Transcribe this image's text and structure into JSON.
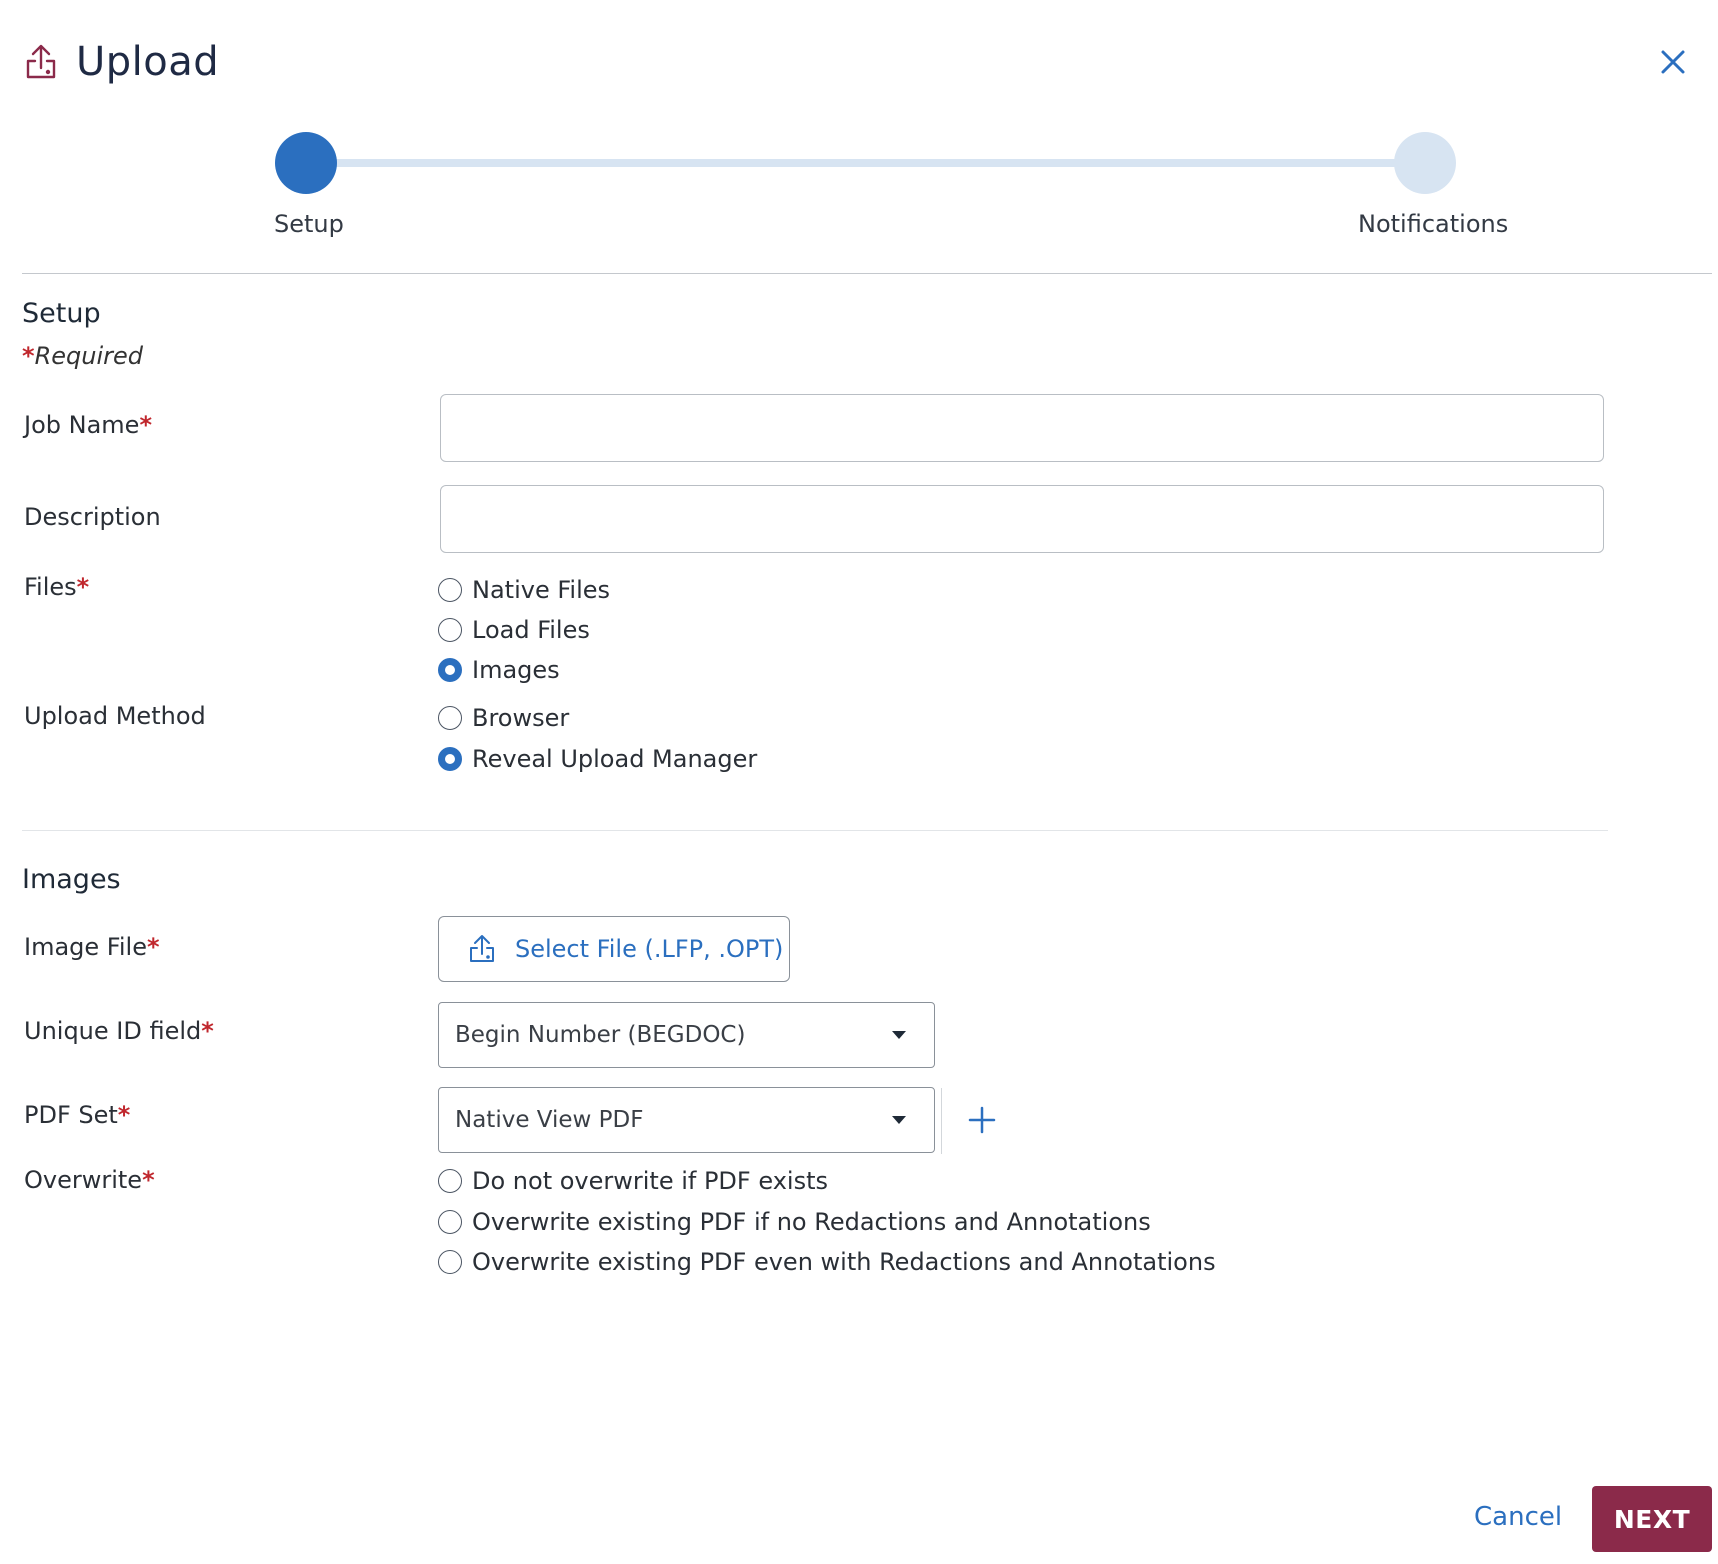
{
  "dialog": {
    "title": "Upload",
    "close_icon": "close-icon",
    "title_icon": "upload-icon"
  },
  "stepper": {
    "steps": [
      {
        "label": "Setup",
        "active": true
      },
      {
        "label": "Notifications",
        "active": false
      }
    ]
  },
  "setup": {
    "heading": "Setup",
    "required_asterisk": "*",
    "required_text": "Required",
    "job_name": {
      "label": "Job Name",
      "value": "",
      "required": true
    },
    "description": {
      "label": "Description",
      "value": ""
    },
    "files": {
      "label": "Files",
      "options": [
        {
          "label": "Native Files",
          "checked": false
        },
        {
          "label": "Load Files",
          "checked": false
        },
        {
          "label": "Images",
          "checked": true
        }
      ]
    },
    "upload_method": {
      "label": "Upload Method",
      "options": [
        {
          "label": "Browser",
          "checked": false
        },
        {
          "label": "Reveal Upload Manager",
          "checked": true
        }
      ]
    }
  },
  "images": {
    "heading": "Images",
    "image_file": {
      "label": "Image File",
      "button_label": "Select File (.LFP, .OPT)"
    },
    "unique_id": {
      "label": "Unique ID field",
      "value": "Begin Number (BEGDOC)"
    },
    "pdf_set": {
      "label": "PDF Set",
      "value": "Native View PDF"
    },
    "overwrite": {
      "label": "Overwrite",
      "options": [
        {
          "label": "Do not overwrite if PDF exists",
          "checked": false
        },
        {
          "label": "Overwrite existing PDF if no Redactions and Annotations",
          "checked": false
        },
        {
          "label": "Overwrite existing PDF even with Redactions and Annotations",
          "checked": false
        }
      ]
    }
  },
  "footer": {
    "cancel_label": "Cancel",
    "next_label": "NEXT"
  },
  "colors": {
    "accent": "#2b6fbf",
    "primary_button": "#8b2a4a",
    "required": "#c0272d"
  }
}
